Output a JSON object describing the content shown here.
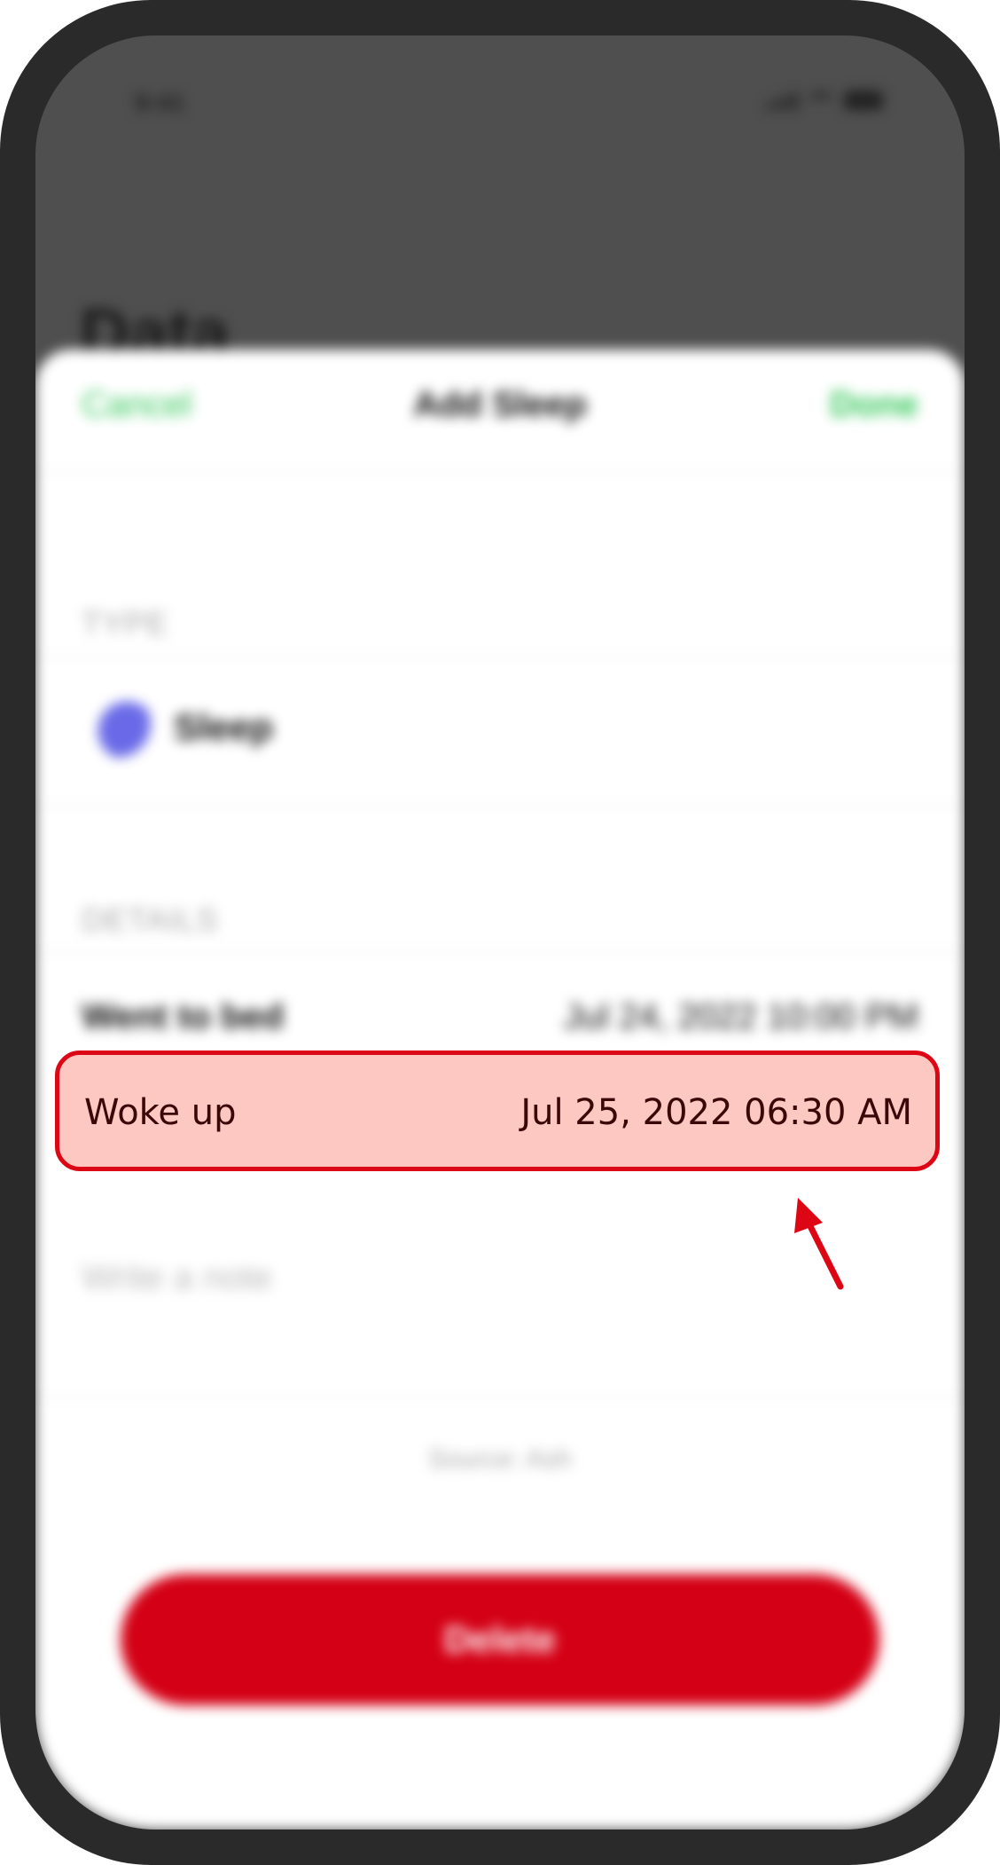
{
  "colors": {
    "accent_green": "#34c759",
    "delete_red": "#d40015",
    "highlight_fill": "#fdc8c2",
    "highlight_border": "#dc0614"
  },
  "background": {
    "page_title": "Data"
  },
  "status_bar": {
    "time": "9:41"
  },
  "sheet": {
    "cancel_label": "Cancel",
    "title": "Add Sleep",
    "done_label": "Done",
    "type_section_label": "TYPE",
    "type_icon": "moon-icon",
    "type_value": "Sleep",
    "details_section_label": "DETAILS",
    "went_to_bed": {
      "label": "Went to bed",
      "value": "Jul 24, 2022 10:00 PM"
    },
    "woke_up": {
      "label": "Woke up",
      "value": "Jul 25, 2022 06:30 AM"
    },
    "note_placeholder": "Write a note",
    "source_text": "Source: Ash",
    "delete_label": "Delete"
  }
}
